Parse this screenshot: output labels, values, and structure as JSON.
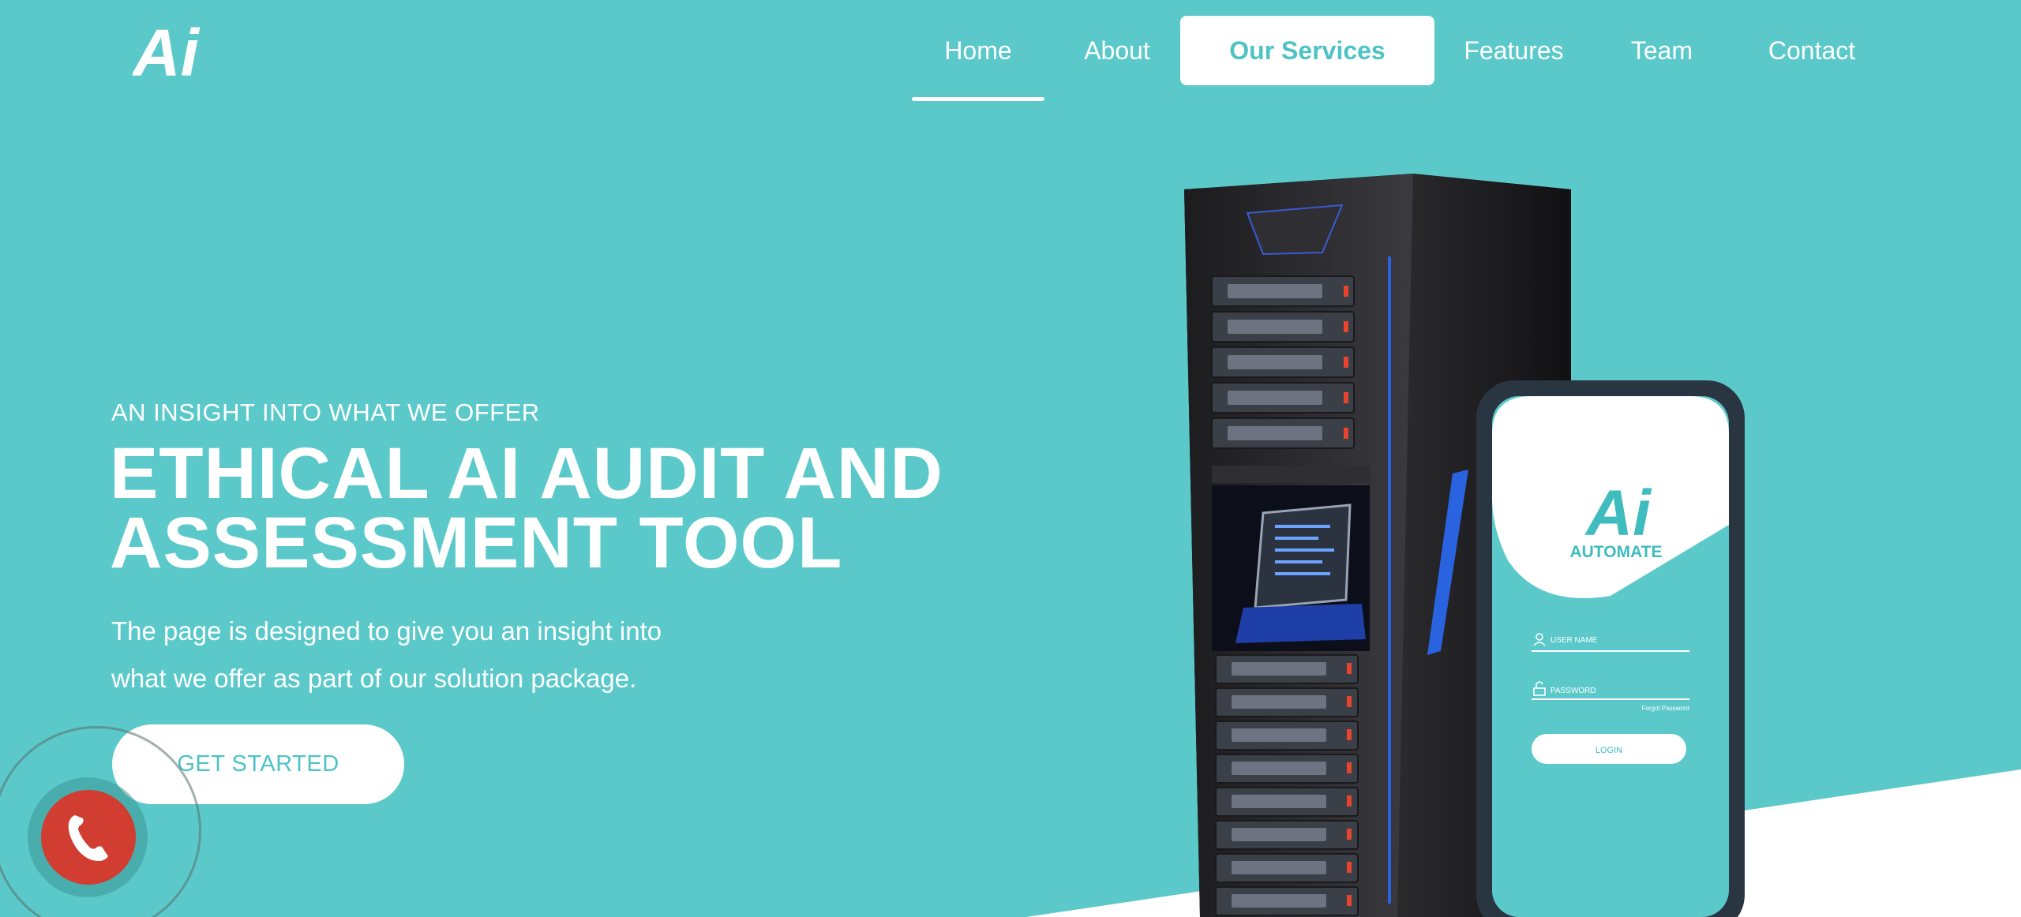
{
  "brand": {
    "logo_text": "Ai"
  },
  "nav": {
    "items": [
      {
        "label": "Home",
        "state": "active"
      },
      {
        "label": "About",
        "state": "normal"
      },
      {
        "label": "Our Services",
        "state": "highlight"
      },
      {
        "label": "Features",
        "state": "normal"
      },
      {
        "label": "Team",
        "state": "normal"
      },
      {
        "label": "Contact",
        "state": "normal"
      }
    ]
  },
  "hero": {
    "eyebrow": "AN INSIGHT INTO WHAT WE OFFER",
    "headline_line1": "ETHICAL AI AUDIT AND",
    "headline_line2": "ASSESSMENT TOOL",
    "description_line1": "The page is designed to give you an insight into",
    "description_line2": "what we offer as part of our solution package.",
    "cta_label": "GET STARTED"
  },
  "phone_mockup": {
    "logo_text": "Ai",
    "brand_text": "AUTOMATE",
    "username_placeholder": "USER NAME",
    "password_placeholder": "PASSWORD",
    "forgot_text": "Forgot Password",
    "login_label": "LOGIN"
  },
  "colors": {
    "background": "#5bc9ca",
    "accent": "#4fc3c4",
    "call_button": "#d13d30"
  },
  "icons": {
    "call": "phone-icon",
    "user": "user-icon",
    "lock": "lock-icon"
  }
}
